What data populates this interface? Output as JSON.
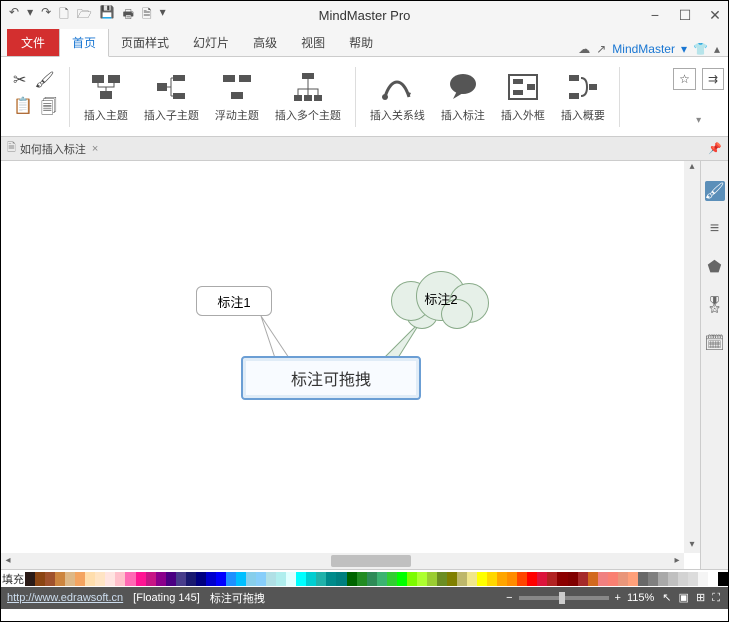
{
  "app_title": "MindMaster Pro",
  "brand_link": "MindMaster",
  "tabs": {
    "file": "文件",
    "items": [
      "首页",
      "页面样式",
      "幻灯片",
      "高级",
      "视图",
      "帮助"
    ],
    "active_index": 0
  },
  "ribbon": {
    "insert_topic": "插入主题",
    "insert_subtopic": "插入子主题",
    "floating_topic": "浮动主题",
    "insert_multiple": "插入多个主题",
    "insert_relation": "插入关系线",
    "insert_callout": "插入标注",
    "insert_boundary": "插入外框",
    "insert_summary": "插入概要"
  },
  "document_tab": {
    "name": "如何插入标注",
    "close": "×"
  },
  "canvas": {
    "central_text": "标注可拖拽",
    "callout1": "标注1",
    "callout2": "标注2"
  },
  "palette_label": "填充",
  "palette_colors": [
    "#2b1b17",
    "#8b4513",
    "#a0522d",
    "#cd853f",
    "#deb887",
    "#f4a460",
    "#ffdead",
    "#ffe4c4",
    "#ffe4e1",
    "#ffc0cb",
    "#ff69b4",
    "#ff1493",
    "#c71585",
    "#8b008b",
    "#4b0082",
    "#483d8b",
    "#191970",
    "#000080",
    "#0000cd",
    "#0000ff",
    "#1e90ff",
    "#00bfff",
    "#87ceeb",
    "#87cefa",
    "#b0e0e6",
    "#afeeee",
    "#e0ffff",
    "#00ffff",
    "#00ced1",
    "#20b2aa",
    "#008b8b",
    "#008080",
    "#006400",
    "#228b22",
    "#2e8b57",
    "#3cb371",
    "#32cd32",
    "#00ff00",
    "#7cfc00",
    "#adff2f",
    "#9acd32",
    "#6b8e23",
    "#808000",
    "#bdb76b",
    "#f0e68c",
    "#ffff00",
    "#ffd700",
    "#ffa500",
    "#ff8c00",
    "#ff4500",
    "#ff0000",
    "#dc143c",
    "#b22222",
    "#8b0000",
    "#800000",
    "#a52a2a",
    "#d2691e",
    "#f08080",
    "#fa8072",
    "#e9967a",
    "#ffa07a",
    "#696969",
    "#808080",
    "#a9a9a9",
    "#c0c0c0",
    "#d3d3d3",
    "#dcdcdc",
    "#f5f5f5",
    "#ffffff",
    "#000000"
  ],
  "status": {
    "url": "http://www.edrawsoft.cn",
    "info": "[Floating 145]",
    "selection": "标注可拖拽",
    "zoom": "115%"
  }
}
